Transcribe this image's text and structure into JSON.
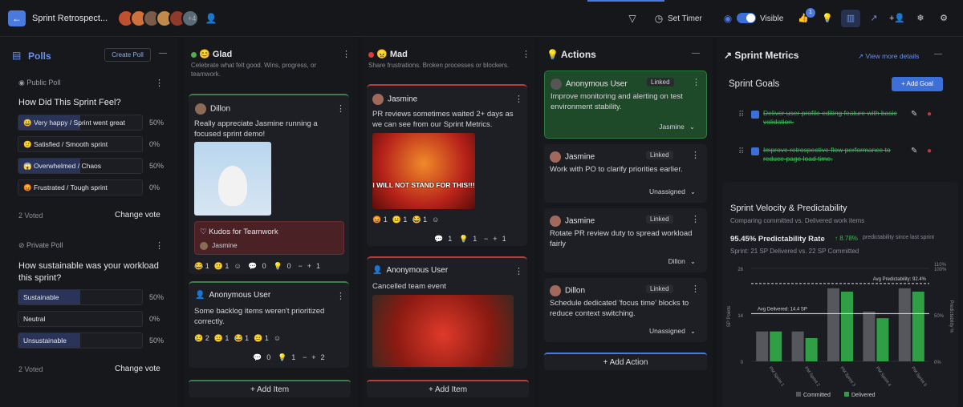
{
  "header": {
    "title": "Sprint Retrospect...",
    "extra_participants": "+4",
    "set_timer": "Set Timer",
    "visible": "Visible",
    "notification_count": "1"
  },
  "polls": {
    "title": "Polls",
    "create": "Create Poll",
    "public": {
      "label": "Public Poll",
      "question": "How Did This Sprint Feel?",
      "options": [
        {
          "label": "😀 Very happy / Sprint went great",
          "pct": "50%",
          "value": 0.5
        },
        {
          "label": "🙂 Satisfied / Smooth sprint",
          "pct": "0%",
          "value": 0
        },
        {
          "label": "😱 Overwhelmed / Chaos",
          "pct": "50%",
          "value": 0.5
        },
        {
          "label": "😡 Frustrated / Tough sprint",
          "pct": "0%",
          "value": 0
        }
      ],
      "voted": "2 Voted",
      "change": "Change vote"
    },
    "private": {
      "label": "Private Poll",
      "question": "How sustainable was your workload this sprint?",
      "options": [
        {
          "label": "Sustainable",
          "pct": "50%",
          "value": 0.5
        },
        {
          "label": "Neutral",
          "pct": "0%",
          "value": 0
        },
        {
          "label": "Unsustainable",
          "pct": "50%",
          "value": 0.5
        }
      ],
      "voted": "2 Voted",
      "change": "Change vote"
    }
  },
  "glad": {
    "title": "Glad",
    "desc": "Celebrate what felt good. Wins, progress, or teamwork.",
    "cards": [
      {
        "author": "Dillon",
        "text": "Really appreciate Jasmine running a focused sprint demo!",
        "kudos_title": "Kudos for Teamwork",
        "kudos_to": "Jasmine",
        "reactions": [
          "😂 1",
          "🙂 1"
        ],
        "comments": "0",
        "ideas": "0",
        "votes": "1"
      },
      {
        "author": "Anonymous User",
        "text": "Some backlog items weren't prioritized correctly.",
        "reactions": [
          "😢 2",
          "😐 1",
          "😂 1",
          "😐 1"
        ],
        "comments": "0",
        "ideas": "1",
        "votes": "2"
      }
    ],
    "add": "Add Item"
  },
  "mad": {
    "title": "Mad",
    "desc": "Share frustrations. Broken processes or blockers.",
    "cards": [
      {
        "author": "Jasmine",
        "text": "PR reviews sometimes waited 2+ days as we can see from our Sprint Metrics.",
        "gif_caption": "I WILL NOT STAND FOR THIS!!!",
        "reactions": [
          "😡 1",
          "😐 1",
          "😂 1"
        ],
        "comments": "1",
        "ideas": "1",
        "votes": "1"
      },
      {
        "author": "Anonymous User",
        "text": "Cancelled team event"
      }
    ],
    "add": "Add Item"
  },
  "actions": {
    "title": "Actions",
    "items": [
      {
        "author": "Anonymous User",
        "linked": "Linked",
        "text": "Improve monitoring and alerting on test environment stability.",
        "assignee": "Jasmine"
      },
      {
        "author": "Jasmine",
        "linked": "Linked",
        "text": "Work with PO to clarify priorities earlier.",
        "assignee": "Unassigned"
      },
      {
        "author": "Jasmine",
        "linked": "Linked",
        "text": "Rotate PR review duty to spread workload fairly",
        "assignee": "Dillon"
      },
      {
        "author": "Dillon",
        "linked": "Linked",
        "text": "Schedule dedicated 'focus time' blocks to reduce context switching.",
        "assignee": "Unassigned"
      }
    ],
    "add": "Add Action"
  },
  "metrics": {
    "title": "Sprint Metrics",
    "view_more": "View more details",
    "goals_title": "Sprint Goals",
    "add_goal": "+ Add Goal",
    "goals": [
      "Deliver user profile editing feature with basic validation.",
      "Improve retrospective flow performance to reduce page load time."
    ],
    "velocity_title": "Sprint Velocity & Predictability",
    "velocity_sub": "Comparing committed vs. Delivered work items",
    "rate_label": "95.45% Predictability Rate",
    "rate_delta": "↑ 8.78%",
    "rate_delta_sub": "predictability since last sprint",
    "sprint_line": "Sprint: 21 SP Delivered vs. 22 SP Committed",
    "avg_pred": "Avg Predictability: 92.4%",
    "avg_deliv": "Avg Delivered: 14.4 SP",
    "ylabel_left": "SP Points",
    "ylabel_right": "Predictability %",
    "legend_committed": "Committed",
    "legend_delivered": "Delivered"
  },
  "chart_data": {
    "type": "bar",
    "categories": [
      "PM Sprint 1",
      "PM Sprint 2",
      "PM Sprint 3",
      "PM Sprint 4",
      "PM Sprint 5"
    ],
    "series": [
      {
        "name": "Committed",
        "values": [
          9,
          9,
          22,
          15,
          22
        ]
      },
      {
        "name": "Delivered",
        "values": [
          9,
          7,
          21,
          13,
          21
        ]
      }
    ],
    "y_left_ticks": [
      "0",
      "14",
      "28"
    ],
    "y_right_ticks": [
      "0%",
      "50%",
      "100%"
    ],
    "y_right_top": "110%",
    "ylim": [
      0,
      28
    ],
    "colors": {
      "committed": "#56575d",
      "delivered": "#2f9e44"
    }
  }
}
